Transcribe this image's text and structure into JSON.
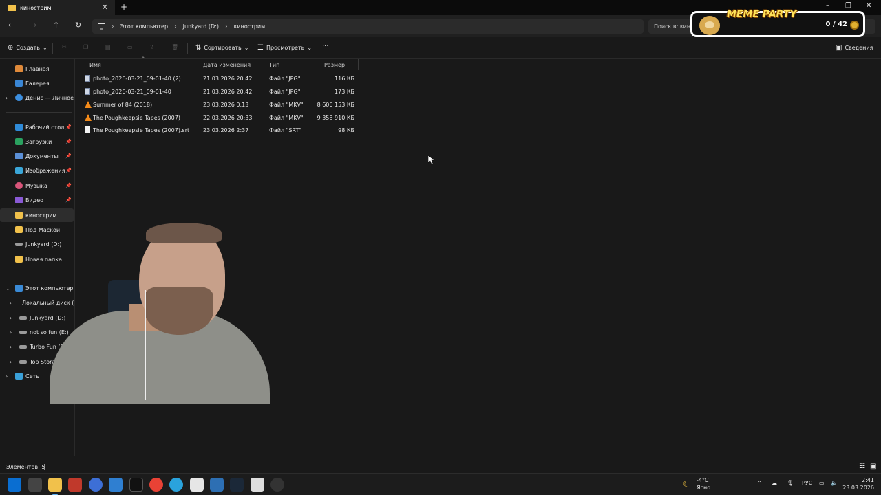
{
  "window": {
    "tab_title": "кинострим",
    "minimize": "–",
    "maximize": "❐",
    "close": "✕"
  },
  "nav": {
    "breadcrumb": [
      "Этот компьютер",
      "Junkyard (D:)",
      "кинострим"
    ],
    "search_placeholder": "Поиск в: кин"
  },
  "overlay": {
    "title": "MEME PARTY",
    "counter": "0 / 42"
  },
  "toolbar": {
    "create": "Создать",
    "sort": "Сортировать",
    "view": "Просмотреть",
    "more": "···",
    "details": "Сведения"
  },
  "sidebar": {
    "home": "Главная",
    "gallery": "Галерея",
    "onedrive": "Денис — Личное",
    "desktop": "Рабочий стол",
    "downloads": "Загрузки",
    "documents": "Документы",
    "pictures": "Изображения",
    "music": "Музыка",
    "videos": "Видео",
    "kinostream": "кинострим",
    "pod_maskoy": "Под Маской",
    "junkyard": "Junkyard (D:)",
    "new_folder": "Новая папка",
    "this_pc": "Этот компьютер",
    "local_disk": "Локальный диск (",
    "junkyard2": "Junkyard (D:)",
    "notsofun": "not so fun (E:)",
    "turbofun": "Turbo Fun (F:)",
    "topstorage": "Top Storage (G:",
    "network": "Сеть"
  },
  "columns": {
    "name": "Имя",
    "date": "Дата изменения",
    "type": "Тип",
    "size": "Размер"
  },
  "files": [
    {
      "name": "photo_2026-03-21_09-01-40 (2)",
      "date": "21.03.2026 20:42",
      "type": "Файл \"JPG\"",
      "size": "116 КБ",
      "icon": "image-file-icon"
    },
    {
      "name": "photo_2026-03-21_09-01-40",
      "date": "21.03.2026 20:42",
      "type": "Файл \"JPG\"",
      "size": "173 КБ",
      "icon": "image-file-icon"
    },
    {
      "name": "Summer of 84 (2018)",
      "date": "23.03.2026 0:13",
      "type": "Файл \"MKV\"",
      "size": "8 606 153 КБ",
      "icon": "vlc-icon"
    },
    {
      "name": "The Poughkeepsie Tapes (2007)",
      "date": "22.03.2026 20:33",
      "type": "Файл \"MKV\"",
      "size": "9 358 910 КБ",
      "icon": "vlc-icon"
    },
    {
      "name": "The Poughkeepsie Tapes (2007).srt",
      "date": "23.03.2026 2:37",
      "type": "Файл \"SRT\"",
      "size": "98 КБ",
      "icon": "text-file-icon"
    }
  ],
  "status": {
    "items": "Элементов: 5"
  },
  "taskbar": {
    "weather_temp": "-4°C",
    "weather_desc": "Ясно",
    "lang": "РУС",
    "time": "2:41",
    "date": "23.03.2026"
  }
}
